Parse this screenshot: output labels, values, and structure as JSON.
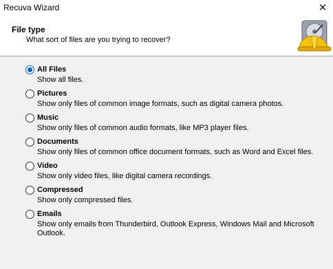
{
  "window": {
    "title": "Recuva Wizard",
    "close_glyph": "✕"
  },
  "header": {
    "heading": "File type",
    "subheading": "What sort of files are you trying to recover?",
    "logo_icon": "recuva-hard-hat-drive-icon"
  },
  "options": [
    {
      "label": "All Files",
      "description": "Show all files.",
      "selected": true
    },
    {
      "label": "Pictures",
      "description": "Show only files of common image formats, such as digital camera photos.",
      "selected": false
    },
    {
      "label": "Music",
      "description": "Show only files of common audio formats, like MP3 player files.",
      "selected": false
    },
    {
      "label": "Documents",
      "description": "Show only files of common office document formats, such as Word and Excel files.",
      "selected": false
    },
    {
      "label": "Video",
      "description": "Show only video files, like digital camera recordings.",
      "selected": false
    },
    {
      "label": "Compressed",
      "description": "Show only compressed files.",
      "selected": false
    },
    {
      "label": "Emails",
      "description": "Show only emails from Thunderbird, Outlook Express, Windows Mail and Microsoft Outlook.",
      "selected": false
    }
  ],
  "colors": {
    "accent": "#0b64c8",
    "header_bg": "#ffffff",
    "body_bg": "#f0f0f0"
  }
}
